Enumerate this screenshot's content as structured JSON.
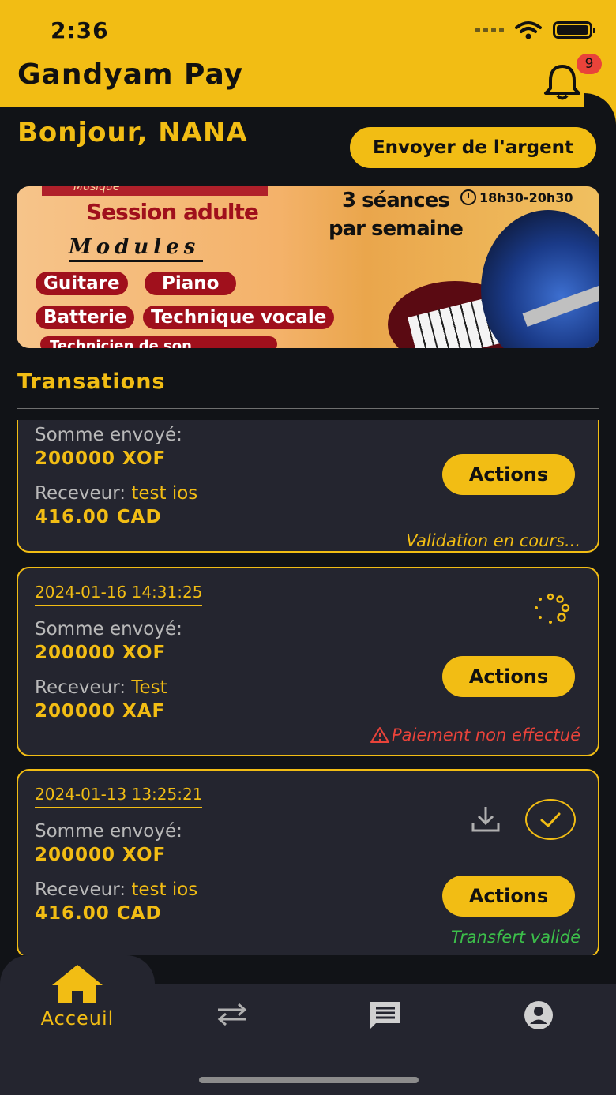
{
  "status_bar": {
    "time": "2:36"
  },
  "header": {
    "title": "Gandyam Pay",
    "notification_count": "9"
  },
  "greeting": "Bonjour, NANA",
  "send_button": "Envoyer de l'argent",
  "banner": {
    "top_text": "Musique",
    "session": "Session adulte",
    "modules_title": "Modules",
    "pills": [
      "Guitare",
      "Piano",
      "Batterie",
      "Technique vocale"
    ],
    "partial_text": "Technicien de son",
    "seances_line1": "3 séances",
    "seances_line2": "par semaine",
    "hours": "18h30-20h30"
  },
  "transactions_title": "Transations",
  "transactions": [
    {
      "date": "",
      "sent_label": "Somme envoyé:",
      "sent_amount": "200000 XOF",
      "receiver_label": "Receveur:",
      "receiver_name": "test ios",
      "received_amount": "416.00 CAD",
      "action_label": "Actions",
      "status": "Validation en cours..."
    },
    {
      "date": "2024-01-16 14:31:25",
      "sent_label": "Somme envoyé:",
      "sent_amount": "200000 XOF",
      "receiver_label": "Receveur:",
      "receiver_name": "Test",
      "received_amount": "200000 XAF",
      "action_label": "Actions",
      "status": "Paiement non effectué"
    },
    {
      "date": "2024-01-13 13:25:21",
      "sent_label": "Somme envoyé:",
      "sent_amount": "200000 XOF",
      "receiver_label": "Receveur:",
      "receiver_name": "test ios",
      "received_amount": "416.00 CAD",
      "action_label": "Actions",
      "status": "Transfert validé"
    }
  ],
  "bottom_nav": {
    "home_label": "Acceuil"
  },
  "colors": {
    "accent": "#f2bd14",
    "background": "#111317",
    "card": "#24252f",
    "error": "#e9433a",
    "success": "#3cbf4a"
  },
  "icons": [
    "home-icon",
    "transfer-icon",
    "message-icon",
    "account-icon",
    "bell-icon",
    "download-icon",
    "check-icon",
    "spinner-icon",
    "warning-icon"
  ]
}
